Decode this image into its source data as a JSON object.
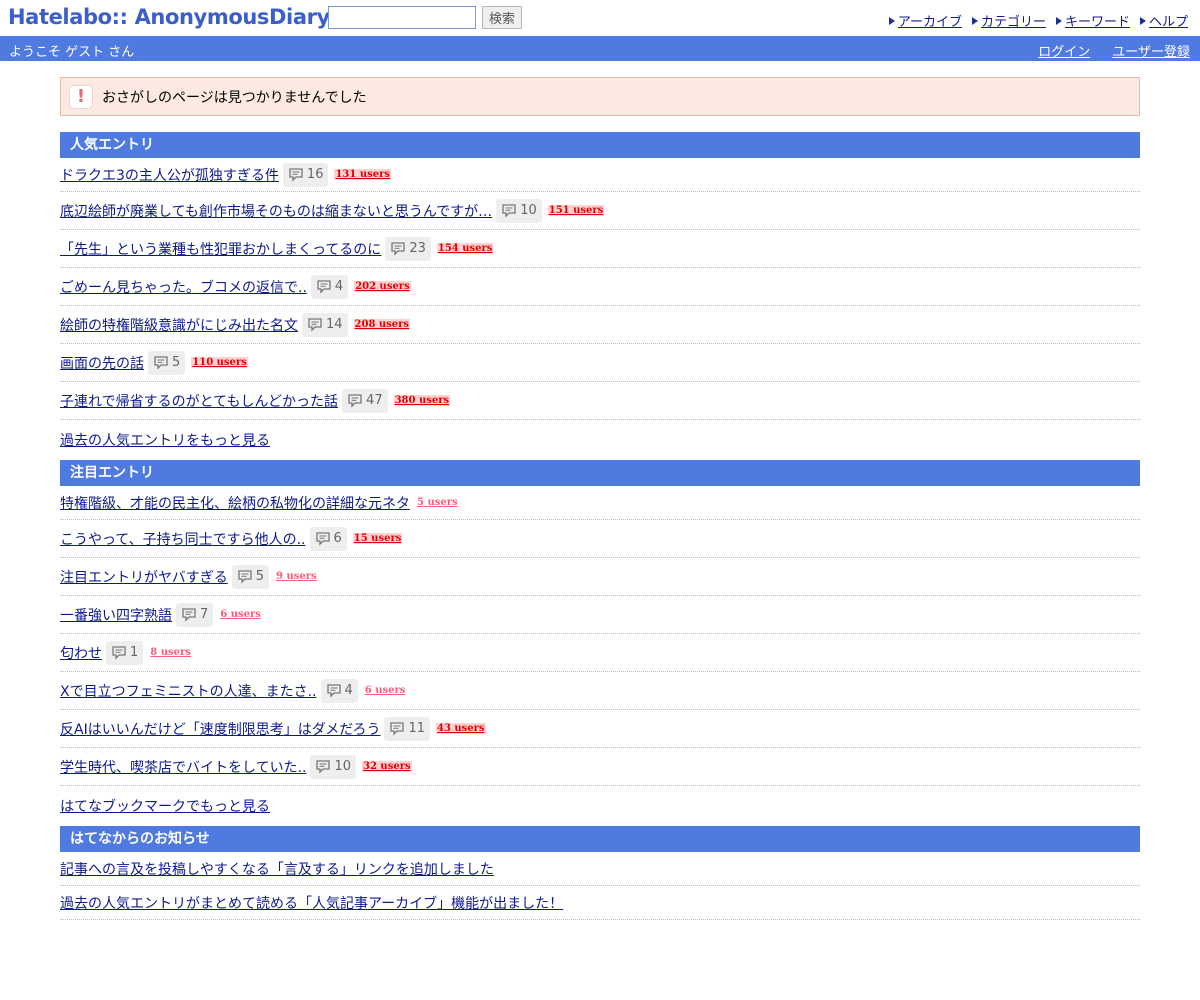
{
  "header": {
    "logo": "Hatelabo:: AnonymousDiary",
    "search": {
      "value": "",
      "placeholder": "",
      "button": "検索"
    },
    "nav": [
      "アーカイブ",
      "カテゴリー",
      "キーワード",
      "ヘルプ"
    ]
  },
  "userbar": {
    "welcome": "ようこそ ゲスト さん",
    "login": "ログイン",
    "register": "ユーザー登録"
  },
  "notice": {
    "text": "おさがしのページは見つかりませんでした"
  },
  "popular": {
    "title": "人気エントリ",
    "entries": [
      {
        "title": "ドラクエ3の主人公が孤独すぎる件",
        "comments": "16",
        "users": "131 users"
      },
      {
        "title": "底辺絵師が廃業しても創作市場そのものは縮まないと思うんですが…",
        "comments": "10",
        "users": "151 users"
      },
      {
        "title": "「先生」という業種も性犯罪おかしまくってるのに",
        "comments": "23",
        "users": "154 users"
      },
      {
        "title": "ごめーん見ちゃった。ブコメの返信で..",
        "comments": "4",
        "users": "202 users"
      },
      {
        "title": "絵師の特権階級意識がにじみ出た名文",
        "comments": "14",
        "users": "208 users"
      },
      {
        "title": "画面の先の話",
        "comments": "5",
        "users": "110 users"
      },
      {
        "title": "子連れで帰省するのがとてもしんどかった話",
        "comments": "47",
        "users": "380 users"
      }
    ],
    "more": "過去の人気エントリをもっと見る"
  },
  "featured": {
    "title": "注目エントリ",
    "entries": [
      {
        "title": "特権階級、才能の民主化、絵柄の私物化の詳細な元ネタ",
        "comments": "",
        "users": "5 users"
      },
      {
        "title": "こうやって、子持ち同士ですら他人の..",
        "comments": "6",
        "users": "15 users"
      },
      {
        "title": "注目エントリがヤバすぎる",
        "comments": "5",
        "users": "9 users"
      },
      {
        "title": "一番強い四字熟語",
        "comments": "7",
        "users": "6 users"
      },
      {
        "title": "匂わせ",
        "comments": "1",
        "users": "8 users"
      },
      {
        "title": "Xで目立つフェミニストの人達、またさ..",
        "comments": "4",
        "users": "6 users"
      },
      {
        "title": "反AIはいいんだけど「速度制限思考」はダメだろう",
        "comments": "11",
        "users": "43 users"
      },
      {
        "title": "学生時代、喫茶店でバイトをしていた..",
        "comments": "10",
        "users": "32 users"
      }
    ],
    "more": "はてなブックマークでもっと見る"
  },
  "news": {
    "title": "はてなからのお知らせ",
    "items": [
      "記事への言及を投稿しやすくなる「言及する」リンクを追加しました",
      "過去の人気エントリがまとめて読める「人気記事アーカイブ」機能が出ました！"
    ]
  },
  "colors": {
    "brand_blue": "#4f7ae0",
    "link": "#0e1a8a",
    "hot_users": "#e00000",
    "mild_users": "#ff5a7a"
  }
}
